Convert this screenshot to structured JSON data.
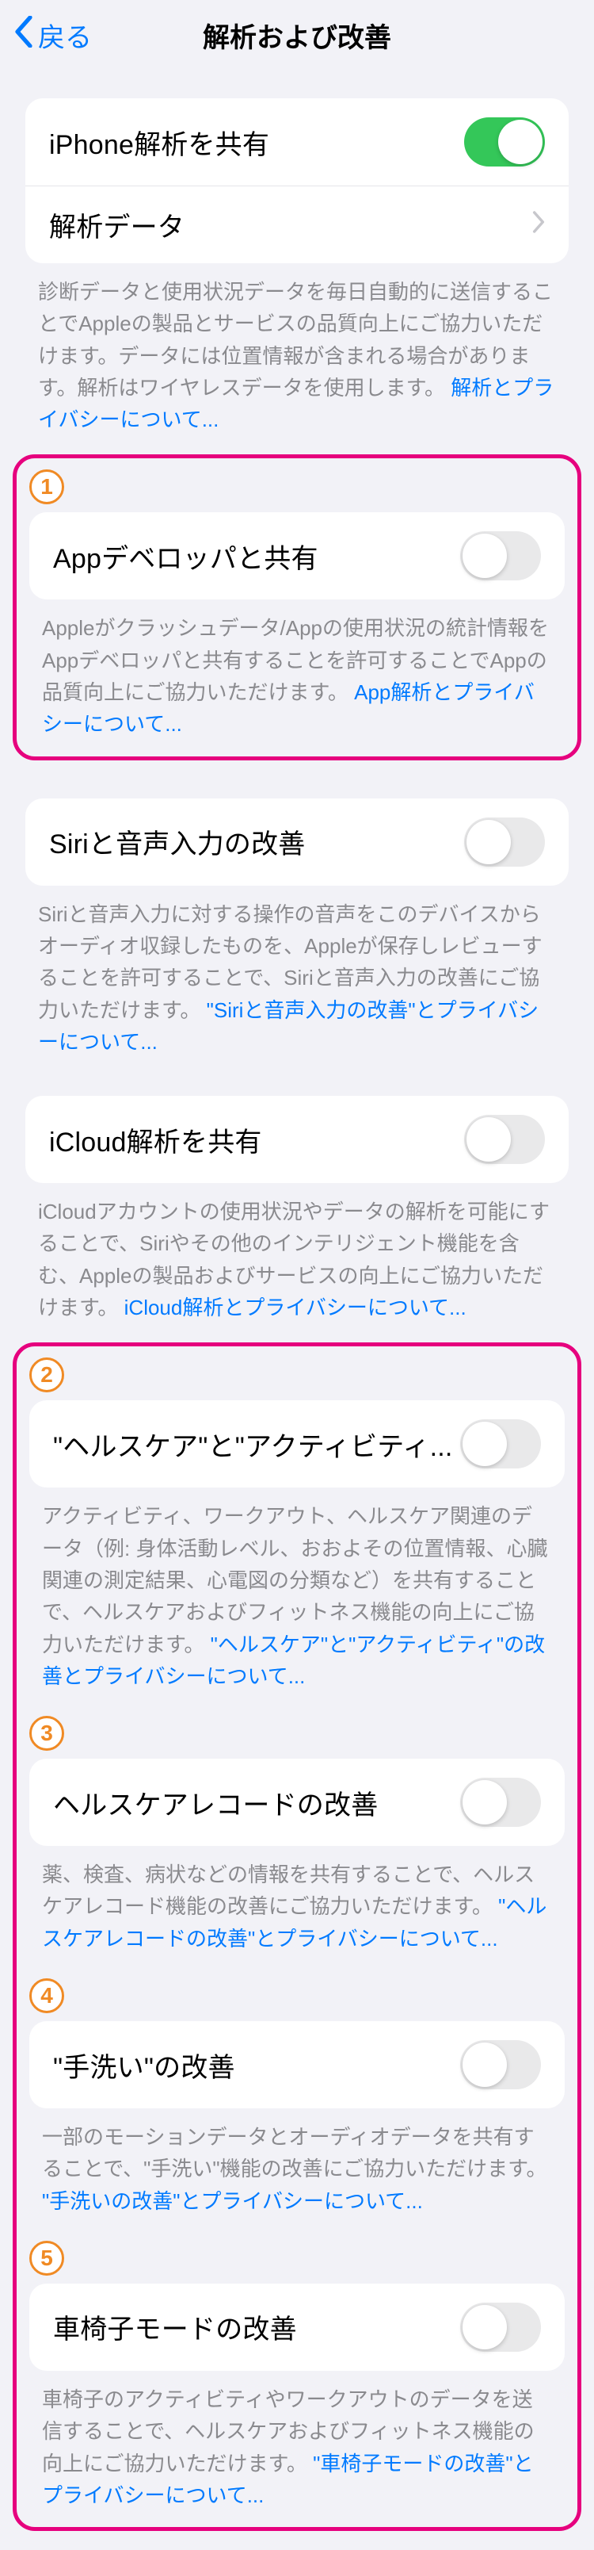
{
  "nav": {
    "back": "戻る",
    "title": "解析および改善"
  },
  "share_iphone": {
    "label": "iPhone解析を共有",
    "on": true
  },
  "analytics_data": {
    "label": "解析データ"
  },
  "share_iphone_footer": {
    "text": "診断データと使用状況データを毎日自動的に送信することでAppleの製品とサービスの品質向上にご協力いただけます。データには位置情報が含まれる場合があります。解析はワイヤレスデータを使用します。",
    "link": "解析とプライバシーについて..."
  },
  "dev": {
    "badge": "1",
    "label": "Appデベロッパと共有",
    "on": false,
    "footer_text": "Appleがクラッシュデータ/Appの使用状況の統計情報をAppデベロッパと共有することを許可することでAppの品質向上にご協力いただけます。",
    "footer_link": "App解析とプライバシーについて..."
  },
  "siri": {
    "label": "Siriと音声入力の改善",
    "on": false,
    "footer_text": "Siriと音声入力に対する操作の音声をこのデバイスからオーディオ収録したものを、Appleが保存しレビューすることを許可することで、Siriと音声入力の改善にご協力いただけます。",
    "footer_link": "\"Siriと音声入力の改善\"とプライバシーについて..."
  },
  "icloud": {
    "label": "iCloud解析を共有",
    "on": false,
    "footer_text": "iCloudアカウントの使用状況やデータの解析を可能にすることで、Siriやその他のインテリジェント機能を含む、Appleの製品およびサービスの向上にご協力いただけます。",
    "footer_link": "iCloud解析とプライバシーについて..."
  },
  "health": {
    "badge": "2",
    "label": "\"ヘルスケア\"と\"アクティビティ...",
    "on": false,
    "footer_text": "アクティビティ、ワークアウト、ヘルスケア関連のデータ（例: 身体活動レベル、おおよその位置情報、心臓関連の測定結果、心電図の分類など）を共有することで、ヘルスケアおよびフィットネス機能の向上にご協力いただけます。",
    "footer_link": "\"ヘルスケア\"と\"アクティビティ\"の改善とプライバシーについて..."
  },
  "records": {
    "badge": "3",
    "label": "ヘルスケアレコードの改善",
    "on": false,
    "footer_text": "薬、検査、病状などの情報を共有することで、ヘルスケアレコード機能の改善にご協力いただけます。",
    "footer_link": "\"ヘルスケアレコードの改善\"とプライバシーについて..."
  },
  "handwash": {
    "badge": "4",
    "label": "\"手洗い\"の改善",
    "on": false,
    "footer_text": "一部のモーションデータとオーディオデータを共有することで、\"手洗い\"機能の改善にご協力いただけます。",
    "footer_link": "\"手洗いの改善\"とプライバシーについて..."
  },
  "wheelchair": {
    "badge": "5",
    "label": "車椅子モードの改善",
    "on": false,
    "footer_text": "車椅子のアクティビティやワークアウトのデータを送信することで、ヘルスケアおよびフィットネス機能の向上にご協力いただけます。",
    "footer_link": "\"車椅子モードの改善\"とプライバシーについて..."
  }
}
